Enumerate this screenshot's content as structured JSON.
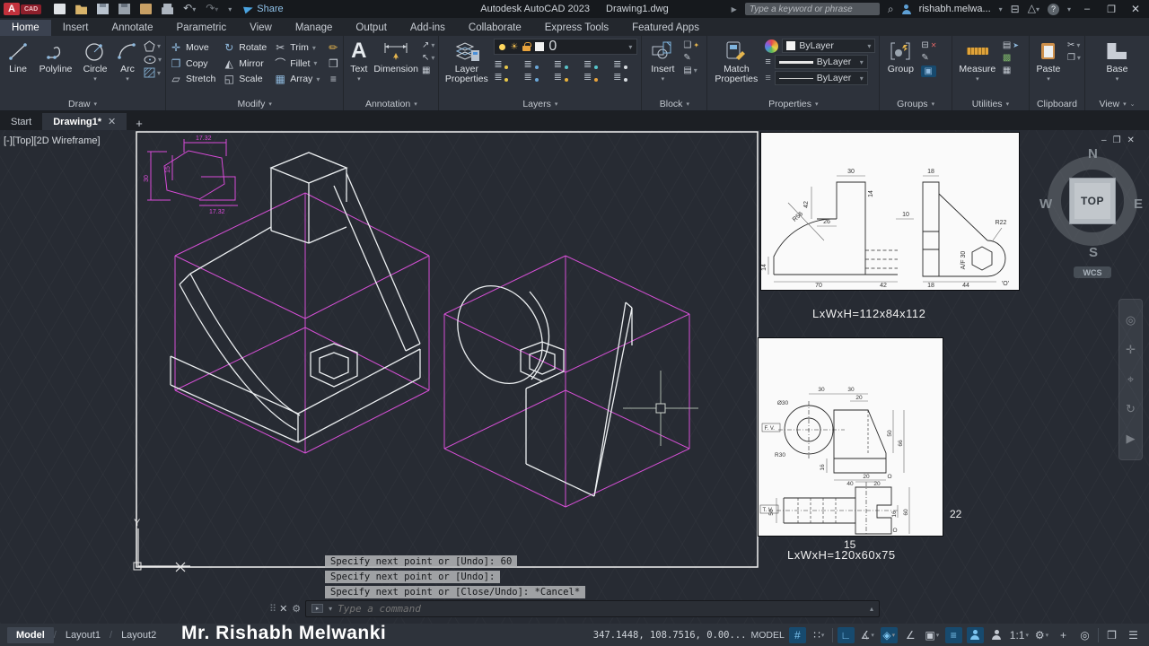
{
  "titlebar": {
    "logo": "A",
    "logo_sub": "CAD",
    "share": "Share",
    "app_title": "Autodesk AutoCAD 2023",
    "doc_title": "Drawing1.dwg",
    "search_placeholder": "Type a keyword or phrase",
    "user": "rishabh.melwa..."
  },
  "ribbon_tabs": [
    "Home",
    "Insert",
    "Annotate",
    "Parametric",
    "View",
    "Manage",
    "Output",
    "Add-ins",
    "Collaborate",
    "Express Tools",
    "Featured Apps"
  ],
  "ribbon": {
    "draw": {
      "label": "Draw",
      "line": "Line",
      "polyline": "Polyline",
      "circle": "Circle",
      "arc": "Arc"
    },
    "modify": {
      "label": "Modify",
      "move": "Move",
      "rotate": "Rotate",
      "trim": "Trim",
      "copy": "Copy",
      "mirror": "Mirror",
      "fillet": "Fillet",
      "stretch": "Stretch",
      "scale": "Scale",
      "array": "Array"
    },
    "annotation": {
      "label": "Annotation",
      "text": "Text",
      "dimension": "Dimension"
    },
    "layers": {
      "label": "Layers",
      "layer_properties": "Layer Properties",
      "current_layer": "0"
    },
    "block": {
      "label": "Block",
      "insert": "Insert"
    },
    "properties": {
      "label": "Properties",
      "match": "Match Properties",
      "color": "ByLayer",
      "lineweight": "ByLayer",
      "linetype": "ByLayer"
    },
    "groups": {
      "label": "Groups",
      "group": "Group"
    },
    "utilities": {
      "label": "Utilities",
      "measure": "Measure"
    },
    "clipboard": {
      "label": "Clipboard",
      "paste": "Paste"
    },
    "view": {
      "label": "View",
      "base": "Base"
    }
  },
  "file_tabs": {
    "start": "Start",
    "drawing": "Drawing1*"
  },
  "viewport": {
    "label": "[-][Top][2D Wireframe]",
    "y_axis": "Y",
    "x_axis": "X"
  },
  "viewcube": {
    "n": "N",
    "w": "W",
    "e": "E",
    "s": "S",
    "top": "TOP",
    "wcs": "WCS"
  },
  "hex_detail": {
    "top": "17.32",
    "left": "30",
    "inner": "15",
    "bottom": "17.32"
  },
  "ref1": {
    "caption": "LxWxH=112x84x112",
    "d30": "30",
    "d18": "18",
    "d14a": "14",
    "d42a": "42",
    "d26": "26",
    "d10": "10",
    "r56": "R56",
    "r22": "R22",
    "af": "A/F 30",
    "d14b": "14",
    "d70": "70",
    "d42b": "42",
    "d18b": "18",
    "d44": "44",
    "o": "'O'"
  },
  "ref2": {
    "caption": "LxWxH=120x60x75",
    "num": "15",
    "side": "22",
    "fv": "F. V.",
    "tv": "T. V.",
    "t30a": "30",
    "t30b": "30",
    "t20": "20",
    "dia": "Ø30",
    "r30": "R30",
    "d50": "50",
    "d66": "66",
    "d16": "16",
    "b40": "40",
    "b20": "20",
    "o1": "O",
    "tv20": "20",
    "tv50": "50",
    "tv16": "16",
    "tv60": "60",
    "o2": "O"
  },
  "command": {
    "history": [
      "Specify next point or [Undo]: 60",
      "Specify next point or [Undo]:",
      "Specify next point or [Close/Undo]: *Cancel*"
    ],
    "placeholder": "Type a command"
  },
  "statusbar": {
    "model": "Model",
    "layout1": "Layout1",
    "layout2": "Layout2",
    "watermark": "Mr. Rishabh Melwanki",
    "coords": "347.1448, 108.7516, 0.00...",
    "badge": "MODEL",
    "scale": "1:1"
  }
}
